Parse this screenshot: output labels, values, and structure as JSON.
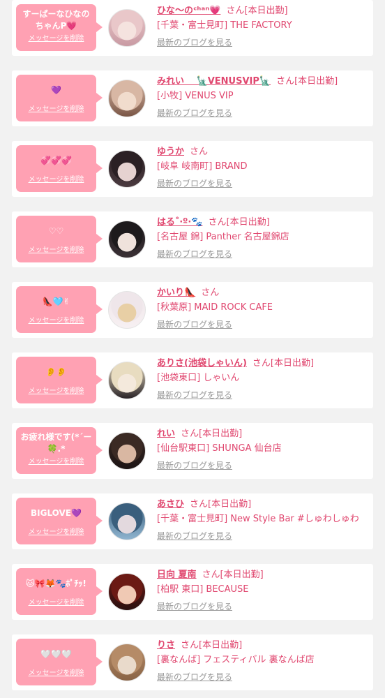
{
  "messages": [
    {
      "bubble_text": "すーぱーなひなの\nちゃんP💗",
      "delete_label": "メッセージを削除",
      "name": "ひな〜のᶜʰᵃⁿ💗",
      "san": "さん",
      "duty": "[本日出勤]",
      "shop": "[千葉・富士見町] THE FACTORY",
      "blog_label": "最新のブログを見る",
      "avatar_colors": [
        "#e9c7c9",
        "#f5e3df",
        "#c99aa3"
      ]
    },
    {
      "bubble_text": "💜",
      "delete_label": "メッセージを削除",
      "name": "みれい 　🗽VENUSVIP🗽",
      "san": "さん",
      "duty": "[本日出勤]",
      "shop": "[小牧] VENUS VIP",
      "blog_label": "最新のブログを見る",
      "avatar_colors": [
        "#d8b7a4",
        "#f1dccd",
        "#7a5646"
      ]
    },
    {
      "bubble_text": "💞💞💞",
      "delete_label": "メッセージを削除",
      "name": "ゆうか",
      "san": "さん",
      "duty": "",
      "shop": "[岐阜 岐南町] BRAND",
      "blog_label": "最新のブログを見る",
      "avatar_colors": [
        "#2b2024",
        "#e6d2d0",
        "#4a3a3f"
      ]
    },
    {
      "bubble_text": "♡♡",
      "delete_label": "メッセージを削除",
      "name": "はる˚‧º·🐾",
      "san": "さん",
      "duty": "[本日出勤]",
      "shop": "[名古屋 錦] Panther 名古屋錦店",
      "blog_label": "最新のブログを見る",
      "avatar_colors": [
        "#1d1a1c",
        "#efe2dc",
        "#3a3035"
      ]
    },
    {
      "bubble_text": "👠🩵✌",
      "delete_label": "メッセージを削除",
      "name": "かいり👠",
      "san": "さん",
      "duty": "",
      "shop": "[秋葉原] MAID ROCK CAFE",
      "blog_label": "最新のブログを見る",
      "avatar_colors": [
        "#efe6ea",
        "#e8cfa5",
        "#f7f0f2"
      ]
    },
    {
      "bubble_text": "👂👂",
      "delete_label": "メッセージを削除",
      "name": "ありさ(池袋しゃいん)",
      "san": "さん",
      "duty": "[本日出勤]",
      "shop": "[池袋東口] しゃいん",
      "blog_label": "最新のブログを見る",
      "avatar_colors": [
        "#e8dcc0",
        "#f4e9dc",
        "#2a2428"
      ]
    },
    {
      "bubble_text": "お疲れ様です(*´ー\n🍀.*",
      "delete_label": "メッセージを削除",
      "name": "れい",
      "san": "さん",
      "duty": "[本日出勤]",
      "shop": "[仙台駅東口] SHUNGA 仙台店",
      "blog_label": "最新のブログを見る",
      "avatar_colors": [
        "#3b2a24",
        "#d9b7a2",
        "#1c1414"
      ]
    },
    {
      "bubble_text": "BIGLOVE💜",
      "delete_label": "メッセージを削除",
      "name": "あさひ",
      "san": "さん",
      "duty": "[本日出勤]",
      "shop": "[千葉・富士見町] New Style Bar #しゅわしゅわ",
      "blog_label": "最新のブログを見る",
      "avatar_colors": [
        "#3a5f7d",
        "#e3d9de",
        "#8fb4cf"
      ]
    },
    {
      "bubble_text": "🐱🎀🦊🐾ﾎﾟﾁｯ!",
      "delete_label": "メッセージを削除",
      "name": "日向 夏南",
      "san": "さん",
      "duty": "[本日出勤]",
      "shop": "[柏駅 東口] BECAUSE",
      "blog_label": "最新のブログを見る",
      "avatar_colors": [
        "#6b1a14",
        "#f0c9b4",
        "#2a1010"
      ]
    },
    {
      "bubble_text": "🤍🤍🤍",
      "delete_label": "メッセージを削除",
      "name": "りさ",
      "san": "さん",
      "duty": "[本日出勤]",
      "shop": "[裏なんば] フェスティバル 裏なんば店",
      "blog_label": "最新のブログを見る",
      "avatar_colors": [
        "#b58b67",
        "#e9dacb",
        "#8a6446"
      ]
    }
  ]
}
